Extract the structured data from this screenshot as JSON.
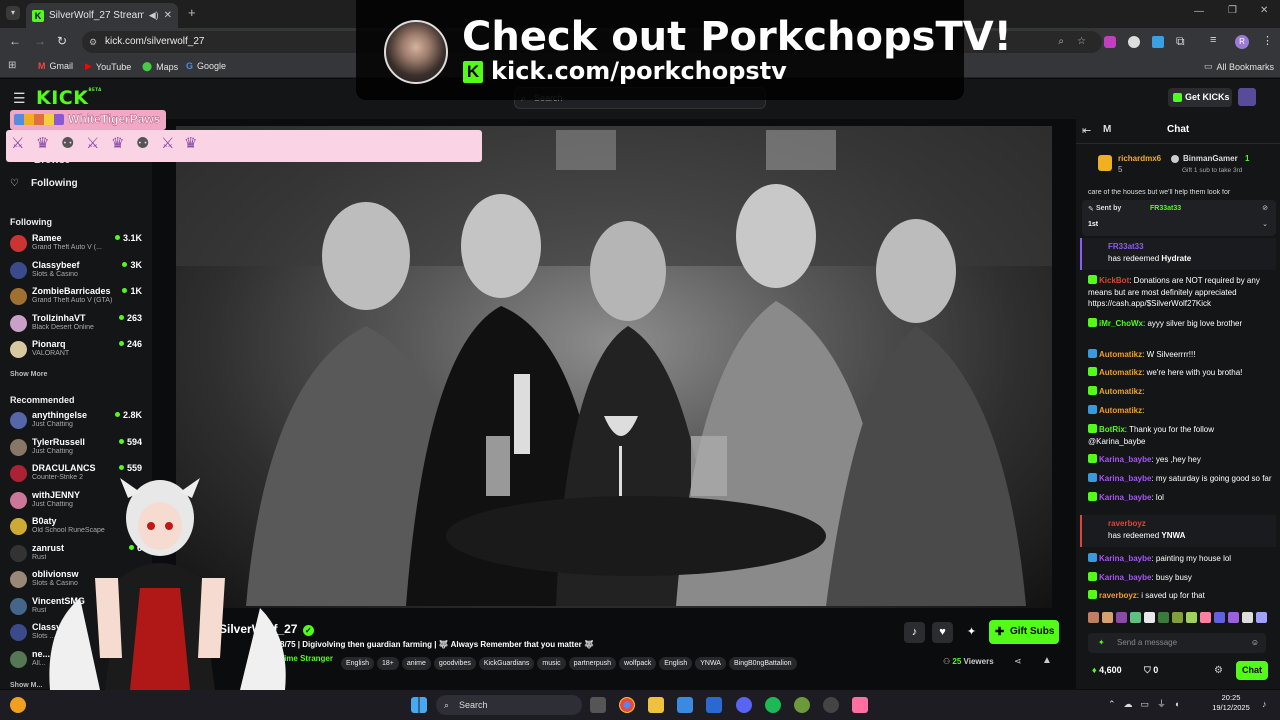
{
  "browser": {
    "tab_title": "SilverWolf_27 Stream - Wa",
    "url": "kick.com/silverwolf_27",
    "bookmarks": [
      "Gmail",
      "YouTube",
      "Maps",
      "Google"
    ],
    "all_bookmarks": "All Bookmarks",
    "profile_letter": "R"
  },
  "header": {
    "logo": "KICK",
    "logo_badge": "BETA",
    "search_placeholder": "Search",
    "get_kicks": "Get KICKs"
  },
  "promo_overlay": {
    "line1": "Check out PorkchopsTV!",
    "line2": "kick.com/porkchopstv"
  },
  "viewer_overlay": {
    "name": "WhiteTigerPaws"
  },
  "sidebar": {
    "browse_label": "Browse",
    "following_nav": "Following",
    "following_heading": "Following",
    "following": [
      {
        "name": "Ramee",
        "category": "Grand Theft Auto V (...",
        "viewers": "3.1K",
        "color": "#c33"
      },
      {
        "name": "Classybeef",
        "category": "Slots & Casino",
        "viewers": "3K",
        "color": "#3b4a8a"
      },
      {
        "name": "ZombieBarricades",
        "category": "Grand Theft Auto V (GTA)",
        "viewers": "1K",
        "color": "#a07030"
      },
      {
        "name": "TrollzinhaVT",
        "category": "Black Desert Online",
        "viewers": "263",
        "color": "#c8a0c8"
      },
      {
        "name": "Pionarq",
        "category": "VALORANT",
        "viewers": "246",
        "color": "#d8c8a0"
      }
    ],
    "show_more": "Show More",
    "recommended_heading": "Recommended",
    "recommended": [
      {
        "name": "anythingelse",
        "category": "Just Chatting",
        "viewers": "2.8K",
        "color": "#5566aa"
      },
      {
        "name": "TylerRussell",
        "category": "Just Chatting",
        "viewers": "594",
        "color": "#887766"
      },
      {
        "name": "DRACULANCS",
        "category": "Counter-Strike 2",
        "viewers": "559",
        "color": "#aa2233"
      },
      {
        "name": "withJENNY",
        "category": "Just Chatting",
        "viewers": "",
        "color": "#cc7799"
      },
      {
        "name": "B0aty",
        "category": "Old School RuneScape",
        "viewers": "",
        "color": "#ccaa33"
      },
      {
        "name": "zanrust",
        "category": "Rust",
        "viewers": "6",
        "color": "#333333"
      },
      {
        "name": "oblivionsw",
        "category": "Slots & Casino",
        "viewers": "",
        "color": "#998877"
      },
      {
        "name": "VincentSMG",
        "category": "Rust",
        "viewers": "",
        "color": "#446688"
      },
      {
        "name": "Classybeef",
        "category": "Slots ...",
        "viewers": "",
        "color": "#3b4a8a"
      },
      {
        "name": "ne...",
        "category": "All...",
        "viewers": "",
        "color": "#557755"
      }
    ],
    "show_more_2": "Show M..."
  },
  "stream": {
    "streamer": "SilverWolf_27",
    "title": "Grind 38/75 | Digivolving then guardian farming | 🐺 Always Remember that you matter 🐺",
    "category": "Story: Time Stranger",
    "tags": [
      "English",
      "18+",
      "anime",
      "goodvibes",
      "KickGuardians",
      "music",
      "partnerpush",
      "wolfpack",
      "English",
      "YNWA",
      "BingB0ngBattalion"
    ],
    "viewers": "25",
    "viewers_label": "Viewers",
    "gift_subs": "Gift Subs"
  },
  "chat": {
    "header_letter": "M",
    "title": "Chat",
    "gifter_top": {
      "name": "richardmx6",
      "count": "5",
      "rank": "1"
    },
    "gifter_second": {
      "name": "BinmanGamer",
      "rank": "1",
      "note": "Gift 1 sub to take 3rd"
    },
    "scrolled_text": "care of the houses but we'll help them look for",
    "pinned": {
      "sent_by": "Sent by",
      "user": "FR33at33",
      "text": "1st"
    },
    "messages": [
      {
        "user": "FR33at33",
        "color": "#8b5cf6",
        "text": "has redeemed",
        "bold": "Hydrate"
      },
      {
        "user": "KickBot",
        "color": "#e0443a",
        "text": ": Donations are NOT required by any means but are most definitely appreciated https://cash.app/$SilverWolf27Kick"
      },
      {
        "user": "iMr_ChoWx",
        "color": "#53fc18",
        "text": ": ayyy silver big love brother"
      },
      {
        "user": "Automatikz",
        "color": "#f0a020",
        "text": ": W Silveerrrr!!!"
      },
      {
        "user": "Automatikz",
        "color": "#f0a020",
        "text": ": we're here with you brotha!"
      },
      {
        "user": "Automatikz",
        "color": "#f0a020",
        "text": ":"
      },
      {
        "user": "Automatikz",
        "color": "#f0a020",
        "text": ":"
      },
      {
        "user": "BotRix",
        "color": "#53fc18",
        "text": ": Thank you for the follow @Karina_baybe"
      },
      {
        "user": "Karina_baybe",
        "color": "#a855f7",
        "text": ": yes ,hey hey"
      },
      {
        "user": "Karina_baybe",
        "color": "#a855f7",
        "text": ": my saturday is going good so far"
      },
      {
        "user": "Karina_baybe",
        "color": "#a855f7",
        "text": ": lol"
      },
      {
        "user": "raverboyz",
        "color": "#e0443a",
        "text": "has redeemed",
        "bold": "YNWA"
      },
      {
        "user": "Karina_baybe",
        "color": "#a855f7",
        "text": ": painting my house lol"
      },
      {
        "user": "Karina_baybe",
        "color": "#a855f7",
        "text": ": busy busy"
      },
      {
        "user": "raverboyz",
        "color": "#f0a020",
        "text": ": i saved up for that"
      }
    ],
    "input_placeholder": "Send a message",
    "kicks_balance": "4,600",
    "points": "0",
    "chat_button": "Chat"
  },
  "taskbar": {
    "search": "Search",
    "time": "20:25",
    "date": "19/12/2025"
  },
  "colors": {
    "kick_green": "#53fc18",
    "background": "#0b0c0d",
    "panel": "#141517"
  }
}
